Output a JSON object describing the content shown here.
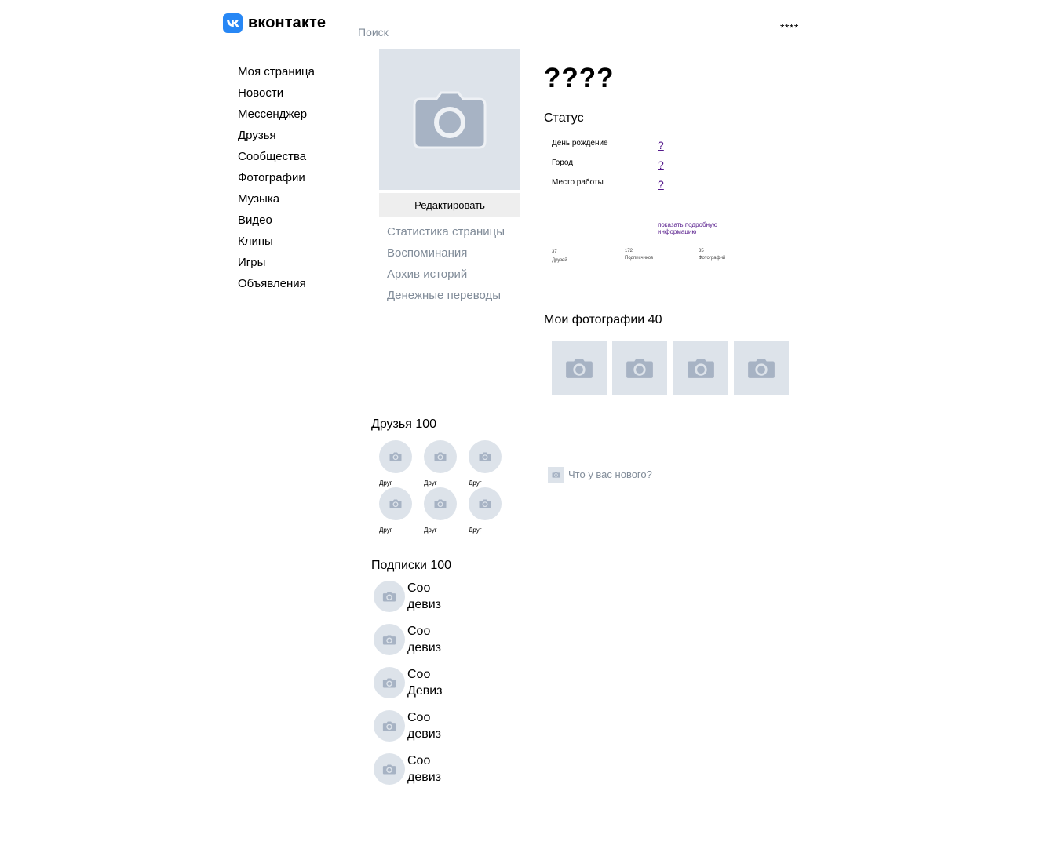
{
  "header": {
    "logo_text": "вконтакте",
    "search_placeholder": "Поиск",
    "user_name": "****"
  },
  "nav": {
    "items": [
      {
        "label": "Моя страница"
      },
      {
        "label": "Новости"
      },
      {
        "label": "Мессенджер"
      },
      {
        "label": "Друзья"
      },
      {
        "label": "Сообщества"
      },
      {
        "label": "Фотографии"
      },
      {
        "label": "Музыка"
      },
      {
        "label": "Видео"
      },
      {
        "label": "Клипы"
      },
      {
        "label": "Игры"
      },
      {
        "label": "Объявления"
      }
    ]
  },
  "profile": {
    "edit_label": "Редактировать",
    "side_links": [
      {
        "label": "Статистика страницы"
      },
      {
        "label": "Воспоминания"
      },
      {
        "label": "Архив историй"
      },
      {
        "label": "Денежные переводы"
      }
    ],
    "name": "????",
    "status": "Статус",
    "info": [
      {
        "label": "День рождение",
        "value": "?"
      },
      {
        "label": "Город",
        "value": "?"
      },
      {
        "label": "Место работы",
        "value": "?"
      }
    ],
    "more_link": "показать подробную информацию",
    "counters": [
      {
        "value": "37",
        "label": "Друзей"
      },
      {
        "value": "172",
        "label": "Подписчиков"
      },
      {
        "value": "35",
        "label": "Фотографий"
      }
    ]
  },
  "photos": {
    "title": "Мои фотографии 40"
  },
  "friends": {
    "title": "Друзья 100",
    "items": [
      {
        "name": "Друг"
      },
      {
        "name": "Друг"
      },
      {
        "name": "Друг"
      },
      {
        "name": "Друг"
      },
      {
        "name": "Друг"
      },
      {
        "name": "Друг"
      }
    ]
  },
  "subscriptions": {
    "title": "Подписки 100",
    "items": [
      {
        "name": "Соо",
        "motto": "девиз"
      },
      {
        "name": "Соо",
        "motto": "девиз"
      },
      {
        "name": "Соо",
        "motto": "Девиз"
      },
      {
        "name": "Соо",
        "motto": "девиз"
      },
      {
        "name": "Соо",
        "motto": "девиз"
      }
    ]
  },
  "post": {
    "placeholder": "Что у вас нового?"
  },
  "icons": {
    "logo": "vk-logo-icon",
    "camera": "camera-icon"
  },
  "colors": {
    "brand": "#2787f5",
    "placeholder_bg": "#dde3ea",
    "camera": "#a7b3c4",
    "muted_text": "#818c99",
    "link": "#551a8b"
  }
}
